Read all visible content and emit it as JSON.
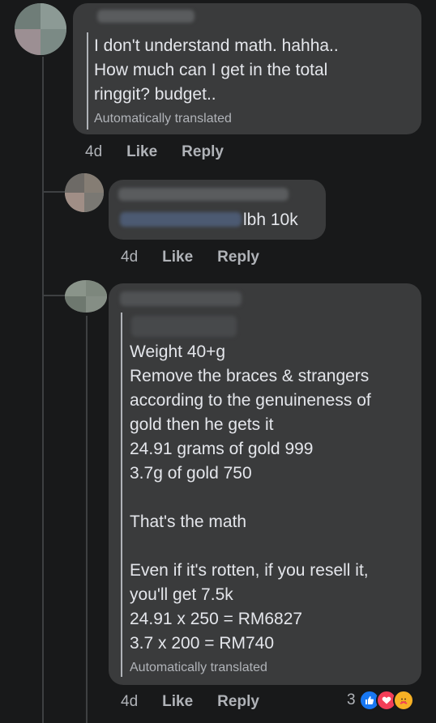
{
  "comment1": {
    "lines": "I don't understand math. hahha..\nHow much can I get in the total\nringgit? budget..",
    "translated_label": "Automatically translated",
    "time": "4d",
    "like": "Like",
    "reply": "Reply"
  },
  "comment2": {
    "text": "lbh 10k",
    "time": "4d",
    "like": "Like",
    "reply": "Reply"
  },
  "comment3": {
    "lines": "Weight 40+g\nRemove the braces & strangers\naccording to the genuineness of\ngold then he gets it\n24.91 grams of gold 999\n3.7g of gold 750\n\nThat's the math\n\nEven if it's rotten, if you resell it,\nyou'll get 7.5k\n24.91 x 250 = RM6827\n3.7 x 200 = RM740",
    "translated_label": "Automatically translated",
    "time": "4d",
    "like": "Like",
    "reply": "Reply",
    "reaction_count": "3",
    "reactions": [
      "like-icon",
      "love-icon",
      "care-icon"
    ]
  },
  "colors": {
    "background": "#18191a",
    "bubble": "#3a3b3c",
    "text": "#e4e6eb",
    "muted": "#b0b3b8",
    "like_blue": "#1877f2",
    "love_red": "#f33e58",
    "care_yellow": "#f7b125"
  }
}
